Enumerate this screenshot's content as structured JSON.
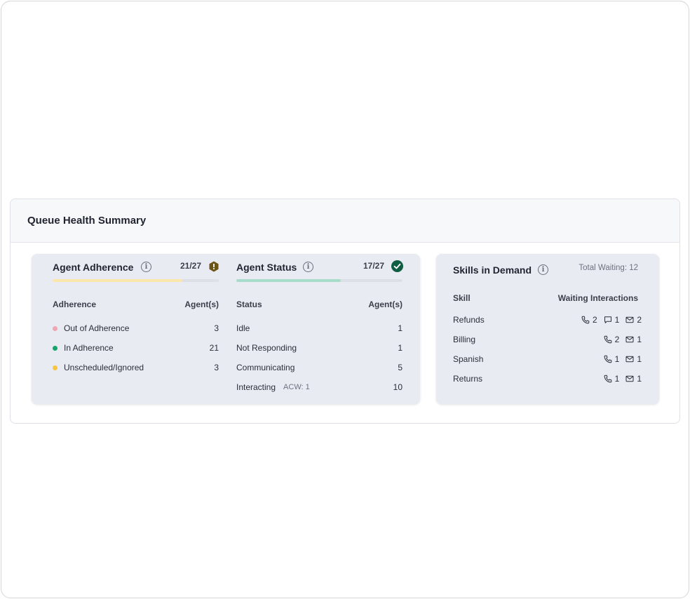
{
  "panel": {
    "title": "Queue Health Summary"
  },
  "adherence": {
    "title": "Agent Adherence",
    "count": "21/27",
    "progress": 0.78,
    "bar_color": "#fae7a9",
    "status_icon": "warning-hexagon-icon",
    "col_label": "Adherence",
    "col_value": "Agent(s)",
    "rows": [
      {
        "label": "Out of Adherence",
        "value": "3",
        "color": "#f0a6b3"
      },
      {
        "label": "In Adherence",
        "value": "21",
        "color": "#14a56a"
      },
      {
        "label": "Unscheduled/Ignored",
        "value": "3",
        "color": "#f7c544"
      }
    ]
  },
  "status": {
    "title": "Agent Status",
    "count": "17/27",
    "progress": 0.63,
    "bar_color": "#a7dccb",
    "status_icon": "check-circle-icon",
    "col_label": "Status",
    "col_value": "Agent(s)",
    "rows": [
      {
        "label": "Idle",
        "sub": "",
        "value": "1"
      },
      {
        "label": "Not Responding",
        "sub": "",
        "value": "1"
      },
      {
        "label": "Communicating",
        "sub": "",
        "value": "5"
      },
      {
        "label": "Interacting",
        "sub": "ACW: 1",
        "value": "10"
      }
    ]
  },
  "skills": {
    "title": "Skills in Demand",
    "total": "Total Waiting: 12",
    "col_skill": "Skill",
    "col_waiting": "Waiting Interactions",
    "rows": [
      {
        "skill": "Refunds",
        "phone": "2",
        "chat": "1",
        "email": "2"
      },
      {
        "skill": "Billing",
        "phone": "2",
        "chat": null,
        "email": "1"
      },
      {
        "skill": "Spanish",
        "phone": "1",
        "chat": null,
        "email": "1"
      },
      {
        "skill": "Returns",
        "phone": "1",
        "chat": null,
        "email": "1"
      }
    ]
  },
  "colors": {
    "warning": "#6b5318",
    "success": "#0f5e43"
  }
}
